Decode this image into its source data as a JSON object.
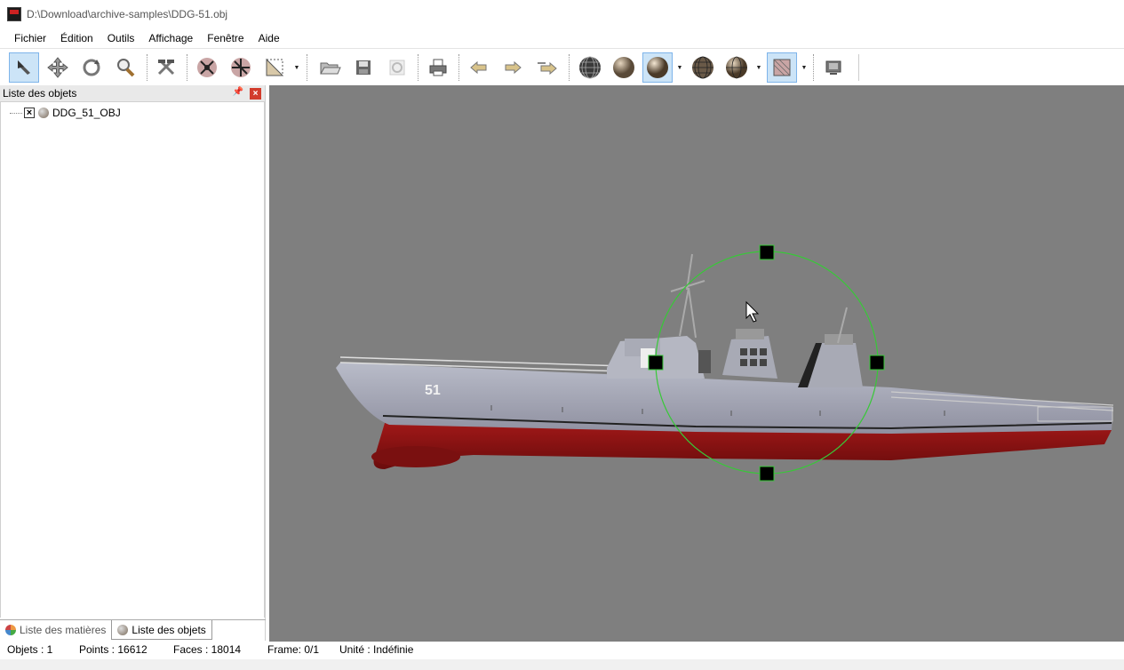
{
  "window": {
    "title": "D:\\Download\\archive-samples\\DDG-51.obj"
  },
  "menu": [
    "Fichier",
    "Édition",
    "Outils",
    "Affichage",
    "Fenêtre",
    "Aide"
  ],
  "toolbar": {
    "tools": [
      {
        "name": "select-arrow-icon",
        "active": true
      },
      {
        "name": "move-icon"
      },
      {
        "name": "rotate-icon"
      },
      {
        "name": "zoom-icon"
      },
      {
        "name": "tools-hammer-icon"
      },
      {
        "name": "points-edit-icon"
      },
      {
        "name": "faces-edit-icon"
      },
      {
        "name": "uv-edit-icon"
      },
      {
        "name": "open-folder-icon"
      },
      {
        "name": "save-disk-icon"
      },
      {
        "name": "render-icon"
      },
      {
        "name": "print-icon"
      },
      {
        "name": "undo-arrow-icon"
      },
      {
        "name": "redo-arrow-icon"
      },
      {
        "name": "repeat-arrow-icon"
      },
      {
        "name": "wireframe-sphere-icon"
      },
      {
        "name": "flat-sphere-icon"
      },
      {
        "name": "smooth-sphere-icon",
        "active": true
      },
      {
        "name": "wire-shaded-sphere-icon"
      },
      {
        "name": "half-shaded-sphere-icon"
      },
      {
        "name": "texture-map-icon",
        "active": true
      },
      {
        "name": "monitor-icon"
      }
    ]
  },
  "panel": {
    "title": "Liste des objets",
    "tree": [
      {
        "label": "DDG_51_OBJ",
        "checked": true
      }
    ],
    "tabs": [
      {
        "label": "Liste des matières",
        "active": false
      },
      {
        "label": "Liste des objets",
        "active": true
      }
    ]
  },
  "viewport": {
    "background": "#7f7f7f",
    "hull_number": "51",
    "gizmo_color": "#38c838"
  },
  "status": {
    "objects": "Objets : 1",
    "points": "Points : 16612",
    "faces": "Faces : 18014",
    "frame": "Frame: 0/1",
    "unit": "Unité : Indéfinie"
  }
}
